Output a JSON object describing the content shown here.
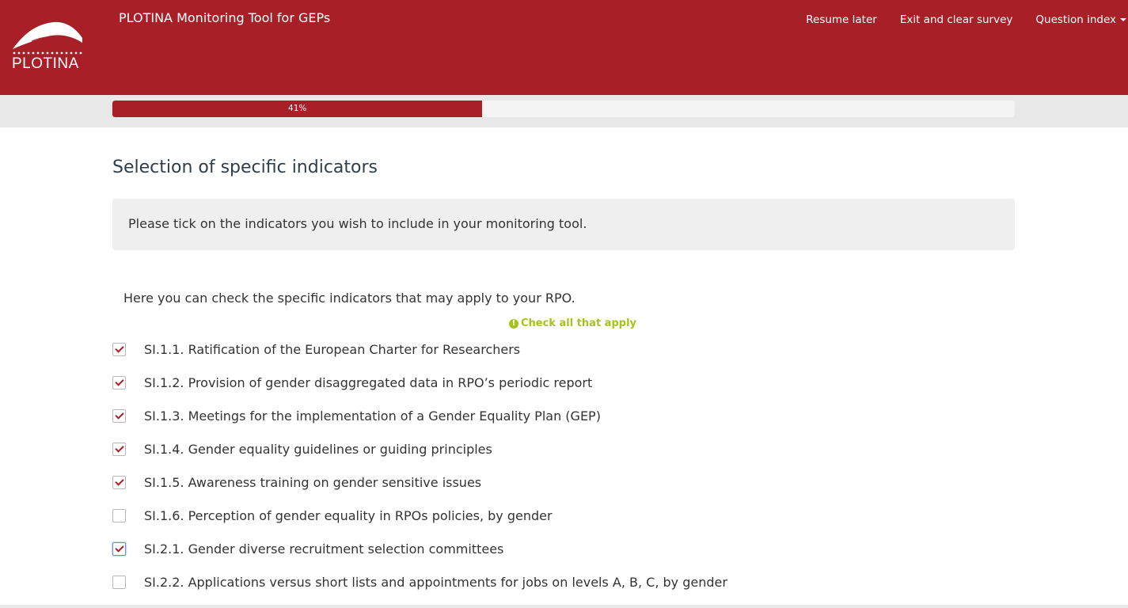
{
  "header": {
    "brand_logo_text": "PLOTINA",
    "app_title": "PLOTINA Monitoring Tool for GEPs",
    "nav": {
      "resume_later": "Resume later",
      "exit_clear": "Exit and clear survey",
      "question_index": "Question index"
    },
    "colors": {
      "brand": "#a91f28"
    }
  },
  "progress": {
    "label": "41%",
    "value": 0.41
  },
  "section": {
    "title": "Selection of specific indicators",
    "info": "Please tick on the indicators you wish to include in your monitoring tool."
  },
  "question": {
    "text": "Here you can check the specific indicators that may apply to your RPO.",
    "hint": "Check all that apply",
    "hint_icon": "exclamation-circle-icon",
    "hint_color": "#a5c41b",
    "options": [
      {
        "label": "SI.1.1. Ratification of the European Charter for Researchers",
        "checked": true
      },
      {
        "label": "SI.1.2. Provision of gender disaggregated data in RPO’s periodic report",
        "checked": true
      },
      {
        "label": "SI.1.3. Meetings for the implementation of a Gender Equality Plan (GEP)",
        "checked": true
      },
      {
        "label": "SI.1.4. Gender equality guidelines or guiding principles",
        "checked": true
      },
      {
        "label": "SI.1.5. Awareness training on gender sensitive issues",
        "checked": true
      },
      {
        "label": "SI.1.6. Perception of gender equality in RPOs policies, by gender",
        "checked": false
      },
      {
        "label": "SI.2.1. Gender diverse recruitment selection committees",
        "checked": true,
        "focused": true
      },
      {
        "label": "SI.2.2. Applications versus short lists and appointments for jobs on levels A, B, C, by gender",
        "checked": false
      }
    ]
  }
}
